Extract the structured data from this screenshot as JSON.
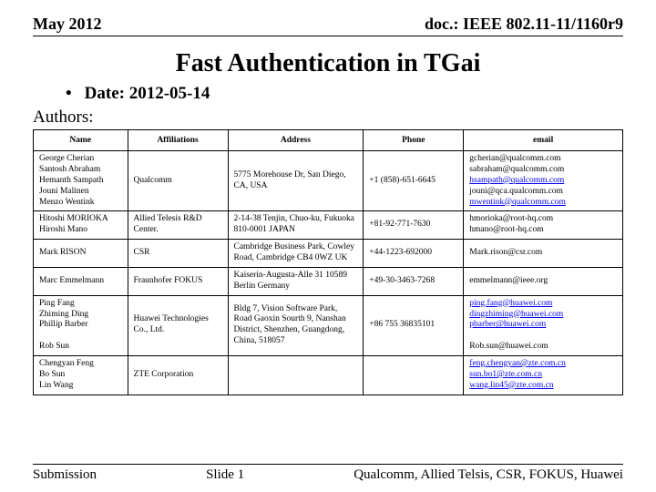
{
  "header": {
    "left": "May 2012",
    "right": "doc.: IEEE 802.11-11/1160r9"
  },
  "title": "Fast Authentication in TGai",
  "date": {
    "label": "Date:",
    "value": "2012-05-14"
  },
  "authors_label": "Authors:",
  "columns": {
    "name": "Name",
    "affil": "Affiliations",
    "addr": "Address",
    "phone": "Phone",
    "email": "email"
  },
  "rows": [
    {
      "names": [
        "George Cherian",
        "Santosh Abraham",
        "Hemanth Sampath",
        "Jouni Malinen",
        "Menzo Wentink"
      ],
      "affil": "Qualcomm",
      "addr": "5775 Morehouse Dr, San Diego, CA, USA",
      "phone": "+1 (858)-651-6645",
      "emails": [
        {
          "t": "gcherian@qualcomm.com",
          "l": false
        },
        {
          "t": "sabraham@qualcomm.com",
          "l": false
        },
        {
          "t": "hsampath@qualcomm.com",
          "l": true
        },
        {
          "t": "jouni@qca.qualcomm.com",
          "l": false
        },
        {
          "t": "mwentink@qualcomm.com",
          "l": true
        }
      ]
    },
    {
      "names": [
        "Hitoshi MORIOKA",
        "Hiroshi Mano"
      ],
      "affil": "Allied Telesis R&D Center.",
      "addr": "2-14-38 Tenjin, Chuo-ku, Fukuoka 810-0001 JAPAN",
      "phone": "+81-92-771-7630",
      "emails": [
        {
          "t": "hmorioka@root-hq.com",
          "l": false
        },
        {
          "t": "hmano@root-hq.com",
          "l": false
        }
      ]
    },
    {
      "names": [
        "Mark RISON"
      ],
      "affil": "CSR",
      "addr": "Cambridge Business Park, Cowley Road, Cambridge CB4 0WZ UK",
      "phone": "+44-1223-692000",
      "emails": [
        {
          "t": "Mark.rison@csr.com",
          "l": false
        }
      ]
    },
    {
      "names": [
        "Marc Emmelmann"
      ],
      "affil": "Fraunhofer FOKUS",
      "addr": "Kaiserin-Augusta-Alle 31 10589 Berlin Germany",
      "phone": "+49-30-3463-7268",
      "emails": [
        {
          "t": "emmelmann@ieee.org",
          "l": false
        }
      ]
    },
    {
      "names": [
        "Ping Fang",
        "Zhiming Ding",
        "Phillip Barber",
        "",
        "Rob Sun"
      ],
      "affil": "Huawei Technologies Co., Ltd.",
      "addr": "Bldg 7, Vision Software Park, Road Gaoxin Sourth 9, Nanshan District, Shenzhen, Guangdong, China, 518057",
      "phone": "+86 755 36835101",
      "emails": [
        {
          "t": "ping.fang@huawei.com",
          "l": true
        },
        {
          "t": "dingzhiming@huawei.com",
          "l": true
        },
        {
          "t": "pbarber@huawei.com",
          "l": true
        },
        {
          "t": "",
          "l": false
        },
        {
          "t": "Rob.sun@huawei.com",
          "l": false
        }
      ]
    },
    {
      "names": [
        "Chengyan Feng",
        "Bo Sun",
        "Lin Wang"
      ],
      "affil": "ZTE Corporation",
      "addr": "",
      "phone": "",
      "emails": [
        {
          "t": "feng.chengyan@zte.com.cn",
          "l": true
        },
        {
          "t": "sun.bo1@zte.com.cn",
          "l": true
        },
        {
          "t": "wang.lin45@zte.com.cn",
          "l": true
        }
      ]
    }
  ],
  "footer": {
    "left": "Submission",
    "center": "Slide 1",
    "right": "Qualcomm, Allied Telsis, CSR, FOKUS, Huawei"
  }
}
